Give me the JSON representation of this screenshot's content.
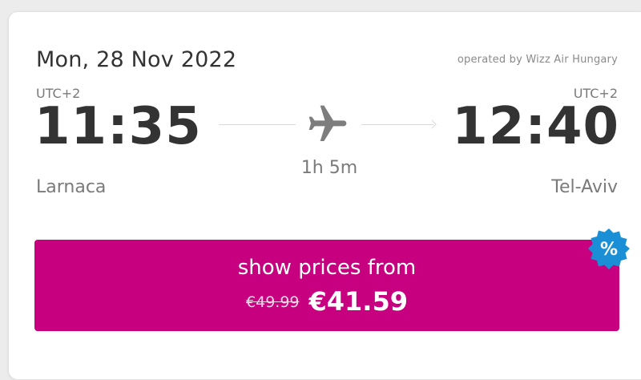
{
  "flight": {
    "date": "Mon, 28 Nov 2022",
    "operator": "operated by Wizz Air Hungary",
    "departure": {
      "timezone": "UTC+2",
      "time": "11:35",
      "city": "Larnaca"
    },
    "arrival": {
      "timezone": "UTC+2",
      "time": "12:40",
      "city": "Tel-Aviv"
    },
    "duration": "1h 5m"
  },
  "price_button": {
    "label": "show prices from",
    "old_price": "€49.99",
    "price": "€41.59"
  },
  "discount_badge": {
    "symbol": "%",
    "color": "#1a8fd6"
  },
  "colors": {
    "accent": "#c6007e",
    "text": "#333333",
    "muted": "#7a7a7a"
  },
  "icons": {
    "route": "airplane-icon",
    "route_end": "arrow-right-icon"
  }
}
